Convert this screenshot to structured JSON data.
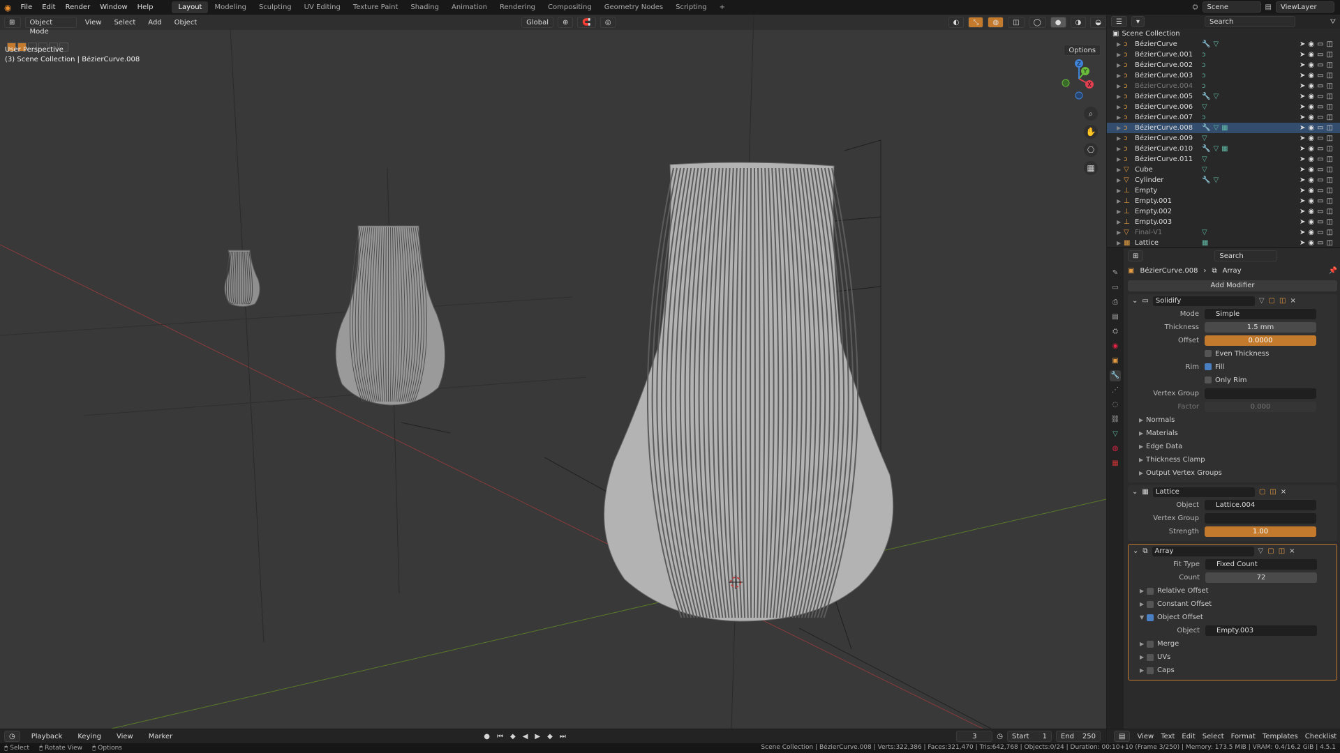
{
  "topbar": {
    "menus": [
      "File",
      "Edit",
      "Render",
      "Window",
      "Help"
    ],
    "tabs": [
      "Layout",
      "Modeling",
      "Sculpting",
      "UV Editing",
      "Texture Paint",
      "Shading",
      "Animation",
      "Rendering",
      "Compositing",
      "Geometry Nodes",
      "Scripting",
      "+"
    ],
    "active_tab": "Layout",
    "scene": "Scene",
    "view_layer": "ViewLayer"
  },
  "viewport": {
    "mode": "Object Mode",
    "menus": [
      "View",
      "Select",
      "Add",
      "Object"
    ],
    "transform": "Global",
    "options": "Options",
    "info_line1": "User Perspective",
    "info_line2": "(3) Scene Collection | BézierCurve.008",
    "gizmo": {
      "x": "X",
      "y": "Y",
      "z": "Z"
    }
  },
  "outliner": {
    "search_placeholder": "Search",
    "collection": "Scene Collection",
    "items": [
      {
        "name": "BézierCurve",
        "icon": "curve-icon",
        "extra": "modifier+mesh"
      },
      {
        "name": "BézierCurve.001",
        "icon": "curve-icon",
        "extra": "curve"
      },
      {
        "name": "BézierCurve.002",
        "icon": "curve-icon",
        "extra": "curve"
      },
      {
        "name": "BézierCurve.003",
        "icon": "curve-icon",
        "extra": "curve"
      },
      {
        "name": "BézierCurve.004",
        "icon": "curve-icon",
        "extra": "curve",
        "dim": true
      },
      {
        "name": "BézierCurve.005",
        "icon": "curve-icon",
        "extra": "modifier+mesh"
      },
      {
        "name": "BézierCurve.006",
        "icon": "curve-icon",
        "extra": "mesh"
      },
      {
        "name": "BézierCurve.007",
        "icon": "curve-icon",
        "extra": "curve"
      },
      {
        "name": "BézierCurve.008",
        "icon": "curve-icon",
        "extra": "modifier+mesh+lattice",
        "selected": true
      },
      {
        "name": "BézierCurve.009",
        "icon": "curve-icon",
        "extra": "mesh"
      },
      {
        "name": "BézierCurve.010",
        "icon": "curve-icon",
        "extra": "modifier+mesh+lattice"
      },
      {
        "name": "BézierCurve.011",
        "icon": "curve-icon",
        "extra": "mesh"
      },
      {
        "name": "Cube",
        "icon": "mesh-icon",
        "extra": "mesh"
      },
      {
        "name": "Cylinder",
        "icon": "mesh-icon",
        "extra": "modifier+mesh"
      },
      {
        "name": "Empty",
        "icon": "empty-icon",
        "extra": ""
      },
      {
        "name": "Empty.001",
        "icon": "empty-icon",
        "extra": ""
      },
      {
        "name": "Empty.002",
        "icon": "empty-icon",
        "extra": ""
      },
      {
        "name": "Empty.003",
        "icon": "empty-icon",
        "extra": ""
      },
      {
        "name": "Final-V1",
        "icon": "mesh-icon",
        "extra": "mesh",
        "dim": true
      },
      {
        "name": "Lattice",
        "icon": "lattice-icon",
        "extra": "lattice"
      }
    ]
  },
  "properties": {
    "search_placeholder": "Search",
    "breadcrumb_object": "BézierCurve.008",
    "breadcrumb_modifier": "Array",
    "add_modifier": "Add Modifier",
    "solidify": {
      "name": "Solidify",
      "mode_label": "Mode",
      "mode": "Simple",
      "thickness_label": "Thickness",
      "thickness": "1.5 mm",
      "offset_label": "Offset",
      "offset": "0.0000",
      "even_thickness": "Even Thickness",
      "rim_label": "Rim",
      "fill": "Fill",
      "only_rim": "Only Rim",
      "vgroup_label": "Vertex Group",
      "factor_label": "Factor",
      "factor": "0.000",
      "subpanels": [
        "Normals",
        "Materials",
        "Edge Data",
        "Thickness Clamp",
        "Output Vertex Groups"
      ]
    },
    "lattice": {
      "name": "Lattice",
      "object_label": "Object",
      "object": "Lattice.004",
      "vgroup_label": "Vertex Group",
      "strength_label": "Strength",
      "strength": "1.00"
    },
    "array": {
      "name": "Array",
      "fit_type_label": "Fit Type",
      "fit_type": "Fixed Count",
      "count_label": "Count",
      "count": "72",
      "relative_offset": "Relative Offset",
      "constant_offset": "Constant Offset",
      "object_offset": "Object Offset",
      "object_label": "Object",
      "object": "Empty.003",
      "subpanels": [
        "Merge",
        "UVs",
        "Caps"
      ]
    }
  },
  "timeline": {
    "menus": [
      "Playback",
      "Keying",
      "View",
      "Marker"
    ],
    "current_frame": "3",
    "start_label": "Start",
    "start": "1",
    "end_label": "End",
    "end": "250"
  },
  "texteditor": {
    "menus": [
      "View",
      "Text",
      "Edit",
      "Select",
      "Format",
      "Templates"
    ],
    "checklist": "Checklist"
  },
  "statusbar": {
    "left": [
      "Select",
      "Rotate View",
      "Options"
    ],
    "right": "Scene Collection | BézierCurve.008 | Verts:322,386 | Faces:321,470 | Tris:642,768 | Objects:0/24 | Duration: 00:10+10 (Frame 3/250) | Memory: 173.5 MiB | VRAM: 0.4/16.2 GiB | 4.5.1"
  },
  "colors": {
    "accent": "#c47a2c",
    "selection": "#334d6e",
    "viewport_bg": "#393939"
  }
}
